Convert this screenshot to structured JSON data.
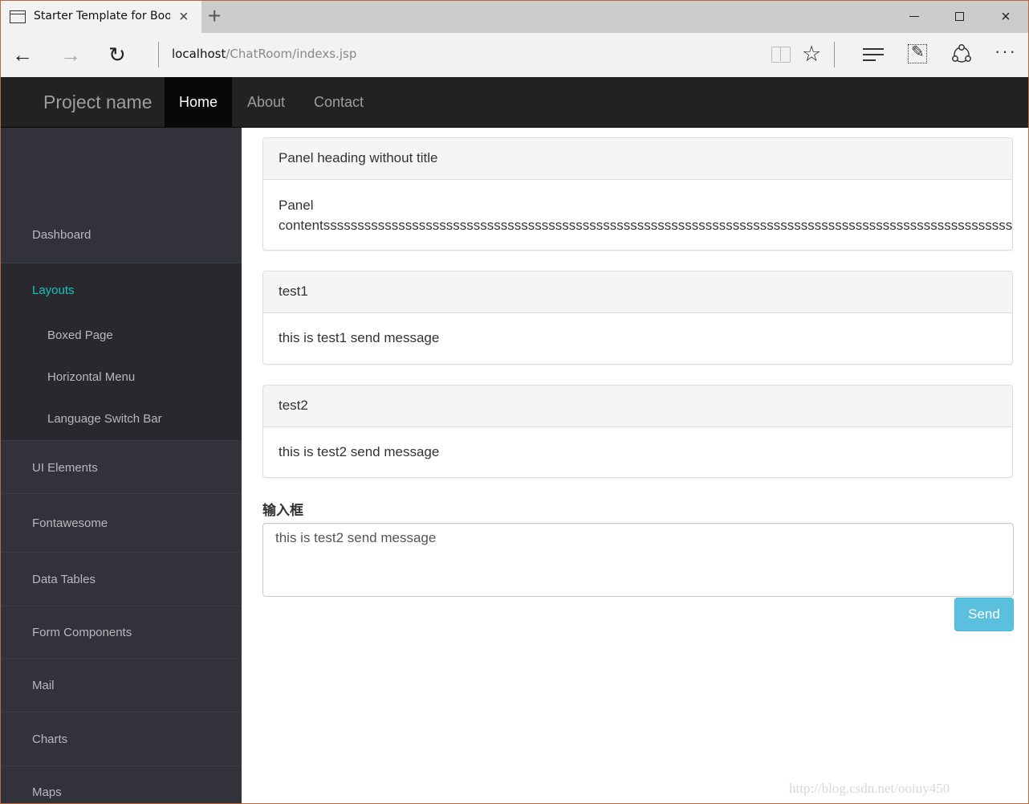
{
  "browser": {
    "tab_title": "Starter Template for Bootstrap",
    "url_host": "localhost",
    "url_path": "/ChatRoom/indexs.jsp",
    "icons": {
      "tab_page": "page-icon",
      "tab_close": "×",
      "new_tab": "+",
      "back": "←",
      "forward": "→",
      "refresh": "↻",
      "reading_view": "book-icon",
      "favorite": "☆",
      "hub": "hub-icon",
      "web_note": "web-note-icon",
      "share": "share-icon",
      "more": "···",
      "minimize": "minimize-icon",
      "maximize": "maximize-icon",
      "close": "×"
    }
  },
  "navbar": {
    "brand": "Project name",
    "links": [
      {
        "label": "Home",
        "active": true
      },
      {
        "label": "About",
        "active": false
      },
      {
        "label": "Contact",
        "active": false
      }
    ]
  },
  "sidebar": {
    "items": [
      {
        "label": "Dashboard"
      },
      {
        "label": "Layouts",
        "active": true,
        "children": [
          "Boxed Page",
          "Horizontal Menu",
          "Language Switch Bar"
        ]
      },
      {
        "label": "UI Elements"
      },
      {
        "label": "Fontawesome"
      },
      {
        "label": "Data Tables"
      },
      {
        "label": "Form Components"
      },
      {
        "label": "Mail"
      },
      {
        "label": "Charts"
      },
      {
        "label": "Maps"
      }
    ],
    "active_color": "#17c3bf"
  },
  "main": {
    "panels": [
      {
        "heading": "Panel heading without title",
        "body_line1": "Panel",
        "body_line2": "contentsssssssssssssssssssssssssssssssssssssssssssssssssssssssssssssssssssssssssssssssssssssssssssssssssssss"
      },
      {
        "heading": "test1",
        "body": "this is test1 send message"
      },
      {
        "heading": "test2",
        "body": "this is test2 send message"
      }
    ],
    "input_label": "输入框",
    "input_value": "this is test2 send message",
    "send_label": "Send",
    "send_color": "#5bc0de"
  },
  "watermark": "http://blog.csdn.net/ooiuy450"
}
